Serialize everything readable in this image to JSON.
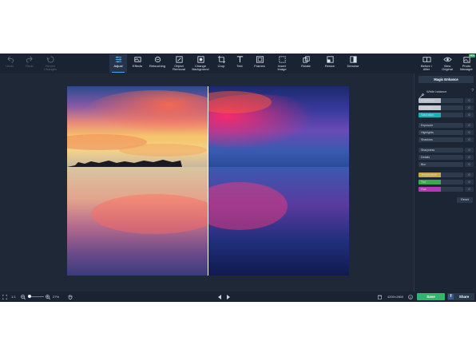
{
  "toolbar": {
    "undo": "Undo",
    "redo": "Redo",
    "revert_line1": "Revert",
    "revert_line2": "Changes",
    "tools": [
      {
        "line1": "Adjust",
        "line2": ""
      },
      {
        "line1": "Effects",
        "line2": ""
      },
      {
        "line1": "Retouching",
        "line2": ""
      },
      {
        "line1": "Object",
        "line2": "Removal"
      },
      {
        "line1": "Change",
        "line2": "Background"
      },
      {
        "line1": "Crop",
        "line2": ""
      },
      {
        "line1": "Text",
        "line2": ""
      },
      {
        "line1": "Frames",
        "line2": ""
      },
      {
        "line1": "Insert",
        "line2": "Image"
      },
      {
        "line1": "Rotate",
        "line2": ""
      },
      {
        "line1": "Resize",
        "line2": ""
      },
      {
        "line1": "Denoise",
        "line2": ""
      }
    ],
    "before_after_line1": "Before /",
    "before_after_line2": "After",
    "view_original_line1": "View",
    "view_original_line2": "Original",
    "photo_manager_line1": "Photo",
    "photo_manager_line2": "Manager",
    "new_badge": "NEW"
  },
  "panel": {
    "magic_enhance": "Magic Enhance",
    "white_balance": "White balance",
    "help": "?",
    "sliders": [
      {
        "name": "Brightness",
        "value": "0",
        "level": 0.5,
        "fill": "#b9c0c8"
      },
      {
        "name": "Contrast",
        "value": "0",
        "level": 0.5,
        "fill": "#c7ccd2"
      },
      {
        "name": "Saturation",
        "value": "0",
        "level": 0.5,
        "fill": "#17b3b8"
      },
      {
        "name": "Exposure",
        "value": "0",
        "level": 0.0,
        "fill": "#3a4a5e"
      },
      {
        "name": "Highlights",
        "value": "0",
        "level": 0.0,
        "fill": "#3a4a5e"
      },
      {
        "name": "Shadows",
        "value": "0",
        "level": 0.0,
        "fill": "#3a4a5e"
      },
      {
        "name": "Sharpness",
        "value": "0",
        "level": 0.0,
        "fill": "#3a4a5e"
      },
      {
        "name": "Details",
        "value": "0",
        "level": 0.0,
        "fill": "#3a4a5e"
      },
      {
        "name": "Blur",
        "value": "0",
        "level": 0.0,
        "fill": "#3a4a5e"
      },
      {
        "name": "Temperature",
        "value": "0",
        "level": 0.5,
        "fill": "#c9a94a"
      },
      {
        "name": "Tint",
        "value": "0",
        "level": 0.5,
        "fill": "#3da84e"
      },
      {
        "name": "Hue",
        "value": "0",
        "level": 0.5,
        "fill": "#b43ab3"
      }
    ],
    "reset": "Reset"
  },
  "bottom": {
    "page": "1:1",
    "zoom": "27%",
    "dimensions": "4200×2800",
    "save": "Save",
    "share": "Share"
  },
  "colors": {
    "accent": "#4aa8e8",
    "save_green": "#2fb66a",
    "background": "#1f2a38"
  }
}
